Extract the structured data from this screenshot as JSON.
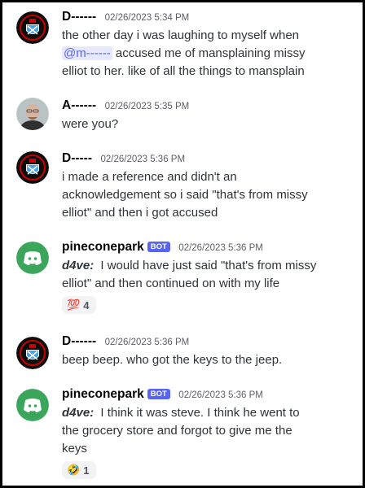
{
  "messages": [
    {
      "username": "D------",
      "timestamp": "02/26/2023 5:34 PM",
      "lines": [
        "the other day i was laughing to myself when"
      ],
      "mention": "@m------",
      "after_mention": " accused me of mansplaining missy",
      "rest_lines": [
        "elliot to her. like of all the things to mansplain"
      ]
    },
    {
      "username": "A------",
      "timestamp": "02/26/2023 5:35 PM",
      "lines": [
        "were you?"
      ]
    },
    {
      "username": "D-----",
      "timestamp": "02/26/2023 5:36 PM",
      "lines": [
        "i made a reference and didn't an",
        "acknowledgement  so i said \"that's from missy",
        "elliot\" and then i got accused"
      ]
    },
    {
      "username": "pineconepark",
      "bot_tag": "BOT",
      "timestamp": "02/26/2023 5:36 PM",
      "author_prefix": "d4ve:",
      "lines": [
        "I would have just said \"that's from missy",
        "elliot\" and then continued on with my life"
      ],
      "reaction": {
        "emoji": "💯",
        "count": "4",
        "icon": "hundred-points-emoji"
      }
    },
    {
      "username": "D------",
      "timestamp": "02/26/2023 5:36 PM",
      "lines": [
        "beep beep. who got the keys to the jeep."
      ]
    },
    {
      "username": "pineconepark",
      "bot_tag": "BOT",
      "timestamp": "02/26/2023 5:36 PM",
      "author_prefix": "d4ve:",
      "lines": [
        "I think it was steve. I think he went to",
        "the grocery store and forgot to give me the",
        "keys"
      ],
      "reaction": {
        "emoji": "🤣",
        "count": "1",
        "icon": "rofl-emoji"
      }
    }
  ],
  "colors": {
    "mention_bg": "#e6e8fd",
    "mention_text": "#5865f2",
    "bot_tag": "#5865f2",
    "discord_avatar": "#3ba55c",
    "crest_bg": "#cc0000"
  }
}
